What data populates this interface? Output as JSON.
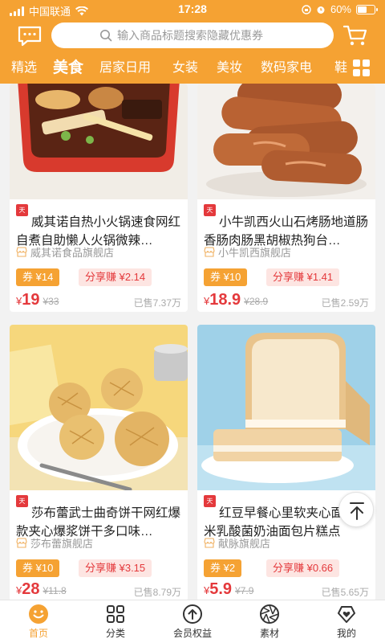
{
  "status_bar": {
    "carrier": "中国联通",
    "time": "17:28",
    "battery": "60%",
    "battery_level": 0.6
  },
  "search": {
    "placeholder": "输入商品标题搜索隐藏优惠券"
  },
  "tabs": [
    {
      "label": "精选",
      "active": false
    },
    {
      "label": "美食",
      "active": true
    },
    {
      "label": "居家日用",
      "active": false
    },
    {
      "label": "女装",
      "active": false
    },
    {
      "label": "美妆",
      "active": false
    },
    {
      "label": "数码家电",
      "active": false
    },
    {
      "label": "鞋",
      "active": false
    }
  ],
  "products": [
    {
      "badge": "天猫",
      "title": "威其诺自热小火锅速食网红自煮自助懒人火锅微辣…",
      "shop": "威其诺食品旗舰店",
      "coupon": "券 ¥14",
      "share": "分享赚 ¥2.14",
      "currency": "¥",
      "price": "19",
      "orig_price": "¥33",
      "sold": "已售7.37万"
    },
    {
      "badge": "天猫",
      "title": "小牛凯西火山石烤肠地道肠香肠肉肠黑胡椒热狗台…",
      "shop": "小牛凯西旗舰店",
      "coupon": "券 ¥10",
      "share": "分享赚 ¥1.41",
      "currency": "¥",
      "price": "18.9",
      "orig_price": "¥28.9",
      "sold": "已售2.59万"
    },
    {
      "badge": "天猫",
      "title": "莎布蕾武士曲奇饼干网红爆款夹心爆浆饼干多口味…",
      "shop": "莎布蕾旗舰店",
      "coupon": "券 ¥10",
      "share": "分享赚 ¥3.15",
      "currency": "¥",
      "price": "28",
      "orig_price": "¥11.8",
      "sold": "已售8.79万"
    },
    {
      "badge": "天猫",
      "title": "红豆早餐心里软夹心面包紫米乳酸菌奶油面包片糕点",
      "shop": "献脉旗舰店",
      "coupon": "券 ¥2",
      "share": "分享赚 ¥0.66",
      "currency": "¥",
      "price": "5.9",
      "orig_price": "¥7.9",
      "sold": "已售5.65万"
    }
  ],
  "bottom_nav": [
    {
      "label": "首页",
      "icon": "home-face-icon",
      "active": true
    },
    {
      "label": "分类",
      "icon": "category-grid-icon",
      "active": false
    },
    {
      "label": "会员权益",
      "icon": "member-up-arrow-icon",
      "active": false
    },
    {
      "label": "素材",
      "icon": "aperture-icon",
      "active": false
    },
    {
      "label": "我的",
      "icon": "heart-shield-icon",
      "active": false
    }
  ],
  "colors": {
    "brand": "#F5A233",
    "price": "#E4393C",
    "share_bg": "#FDE5E2"
  }
}
